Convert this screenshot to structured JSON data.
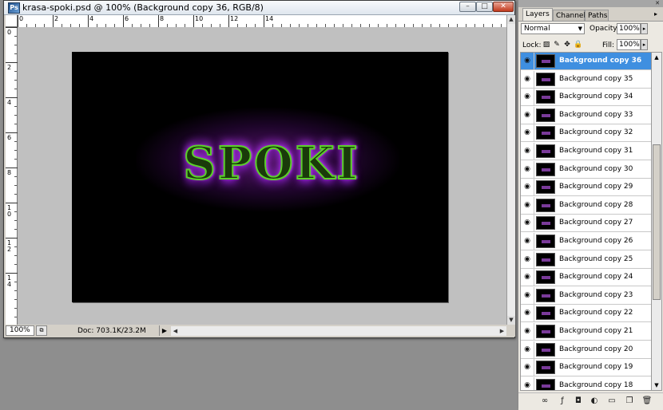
{
  "document": {
    "title": "krasa-spoki.psd @ 100% (Background copy 36, RGB/8)",
    "zoom": "100%",
    "doc_info": "Doc: 703.1K/23.2M",
    "canvas_text": "SPOKI",
    "ruler_top_labels": [
      "0",
      "2",
      "4",
      "6",
      "8",
      "10",
      "12",
      "14"
    ],
    "ruler_left_labels": [
      "0",
      "2",
      "4",
      "6",
      "8",
      "10",
      "12",
      "14"
    ]
  },
  "window_buttons": {
    "minimize": "–",
    "maximize": "□",
    "close": "✕"
  },
  "panel": {
    "tabs": [
      "Layers",
      "Channels",
      "Paths"
    ],
    "blend_mode": "Normal",
    "opacity_label": "Opacity:",
    "opacity_value": "100%",
    "lock_label": "Lock:",
    "fill_label": "Fill:",
    "fill_value": "100%",
    "layers": [
      {
        "name": "Background copy 36",
        "selected": true
      },
      {
        "name": "Background copy 35"
      },
      {
        "name": "Background copy 34"
      },
      {
        "name": "Background copy 33"
      },
      {
        "name": "Background copy 32"
      },
      {
        "name": "Background copy 31"
      },
      {
        "name": "Background copy 30"
      },
      {
        "name": "Background copy 29"
      },
      {
        "name": "Background copy 28"
      },
      {
        "name": "Background copy 27"
      },
      {
        "name": "Background copy 26"
      },
      {
        "name": "Background copy 25"
      },
      {
        "name": "Background copy 24"
      },
      {
        "name": "Background copy 23"
      },
      {
        "name": "Background copy 22"
      },
      {
        "name": "Background copy 21"
      },
      {
        "name": "Background copy 20"
      },
      {
        "name": "Background copy 19"
      },
      {
        "name": "Background copy 18"
      }
    ]
  },
  "colors": {
    "selected_layer": "#3f8fe0",
    "glow_purple": "#a030d8",
    "text_green": "#5bd02a"
  }
}
